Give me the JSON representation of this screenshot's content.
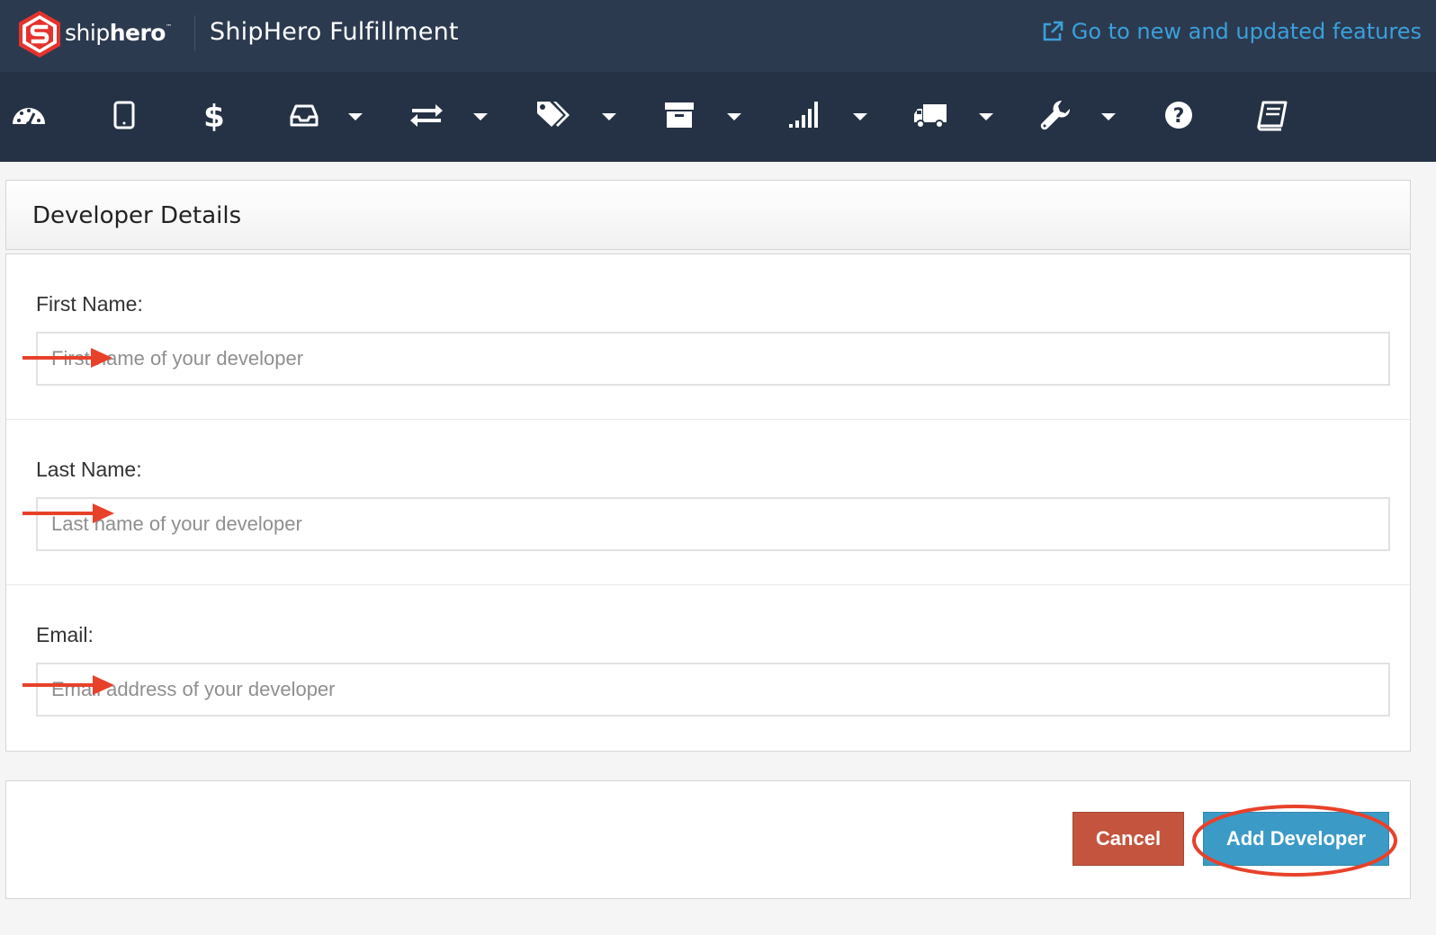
{
  "header": {
    "brand_prefix": "ship",
    "brand_suffix": "hero",
    "brand_tm": "™",
    "app_title": "ShipHero Fulfillment",
    "new_features_link": "Go to new and updated features"
  },
  "nav": {
    "items": [
      {
        "name": "dashboard",
        "icon": "dashboard-icon",
        "has_dropdown": false
      },
      {
        "name": "mobile",
        "icon": "tablet-icon",
        "has_dropdown": false
      },
      {
        "name": "billing",
        "icon": "dollar-icon",
        "has_dropdown": false
      },
      {
        "name": "inbox",
        "icon": "inbox-icon",
        "has_dropdown": true
      },
      {
        "name": "transfers",
        "icon": "exchange-icon",
        "has_dropdown": true
      },
      {
        "name": "tags",
        "icon": "tags-icon",
        "has_dropdown": true
      },
      {
        "name": "archive",
        "icon": "archive-icon",
        "has_dropdown": true
      },
      {
        "name": "reports",
        "icon": "signal-icon",
        "has_dropdown": true
      },
      {
        "name": "shipping",
        "icon": "truck-icon",
        "has_dropdown": true
      },
      {
        "name": "settings",
        "icon": "wrench-icon",
        "has_dropdown": true
      },
      {
        "name": "help",
        "icon": "question-circle-icon",
        "has_dropdown": false
      },
      {
        "name": "docs",
        "icon": "book-icon",
        "has_dropdown": false
      }
    ]
  },
  "form": {
    "title": "Developer Details",
    "fields": [
      {
        "label": "First Name:",
        "placeholder": "First name of your developer",
        "value": ""
      },
      {
        "label": "Last Name:",
        "placeholder": "Last name of your developer",
        "value": ""
      },
      {
        "label": "Email:",
        "placeholder": "Email address of your developer",
        "value": ""
      }
    ],
    "cancel_label": "Cancel",
    "submit_label": "Add Developer"
  },
  "colors": {
    "topbar": "#2c3a4f",
    "navbar": "#253245",
    "link": "#3aa0dc",
    "cancel": "#c4543d",
    "submit": "#3b9bc6",
    "annotation": "#e8412a"
  }
}
